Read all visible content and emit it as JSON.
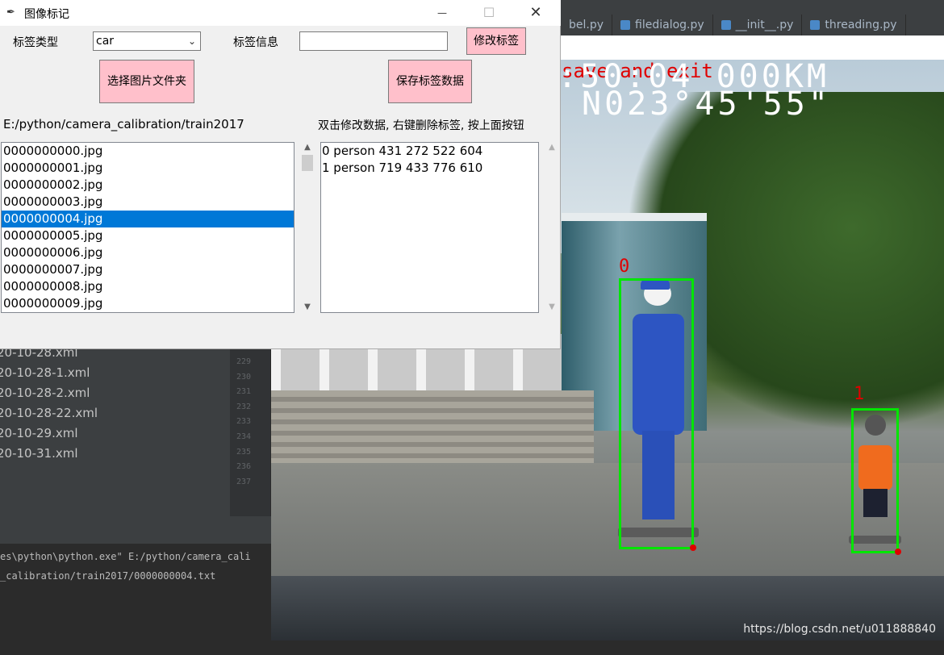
{
  "window": {
    "title": "图像标记",
    "minimize": "—",
    "maximize": "☐",
    "close": "✕"
  },
  "form": {
    "label_type_caption": "标签类型",
    "label_type_value": "car",
    "label_info_caption": "标签信息",
    "label_info_value": "",
    "modify_label_button": "修改标签",
    "select_folder_button": "选择图片文件夹",
    "save_label_button": "保存标签数据",
    "folder_path": "E:/python/camera_calibration/train2017",
    "hint": "双击修改数据, 右键删除标签, 按上面按钮"
  },
  "file_list": {
    "items": [
      "0000000000.jpg",
      "0000000001.jpg",
      "0000000002.jpg",
      "0000000003.jpg",
      "0000000004.jpg",
      "0000000005.jpg",
      "0000000006.jpg",
      "0000000007.jpg",
      "0000000008.jpg",
      "0000000009.jpg"
    ],
    "selected_index": 4
  },
  "annotations": {
    "items": [
      "0 person 431 272 522 604",
      "1 person 719 433 776 610"
    ]
  },
  "ide": {
    "tabs": [
      "bel.py",
      "filedialog.py",
      "__init__.py",
      "threading.py"
    ],
    "files": [
      "20-10-28.xml",
      "20-10-28-1.xml",
      "20-10-28-2.xml",
      "20-10-28-22.xml",
      "20-10-29.xml",
      "20-10-31.xml"
    ],
    "line_numbers": [
      "229",
      "230",
      "231",
      "232",
      "233",
      "234",
      "235",
      "236",
      "237"
    ],
    "console": [
      "es\\python\\python.exe\" E:/python/camera_cali",
      "_calibration/train2017/0000000004.txt"
    ]
  },
  "viewer": {
    "overlay_line1": ":50:04  000KM",
    "overlay_line2": "N023°45'55\"",
    "save_hint": "save and exit",
    "box_labels": [
      "0",
      "1"
    ],
    "watermark": "https://blog.csdn.net/u011888840"
  },
  "colors": {
    "bbox": "#00e600",
    "bbox_label": "#e00000",
    "selection": "#0078d7",
    "pink_button": "#ffc0cb"
  }
}
